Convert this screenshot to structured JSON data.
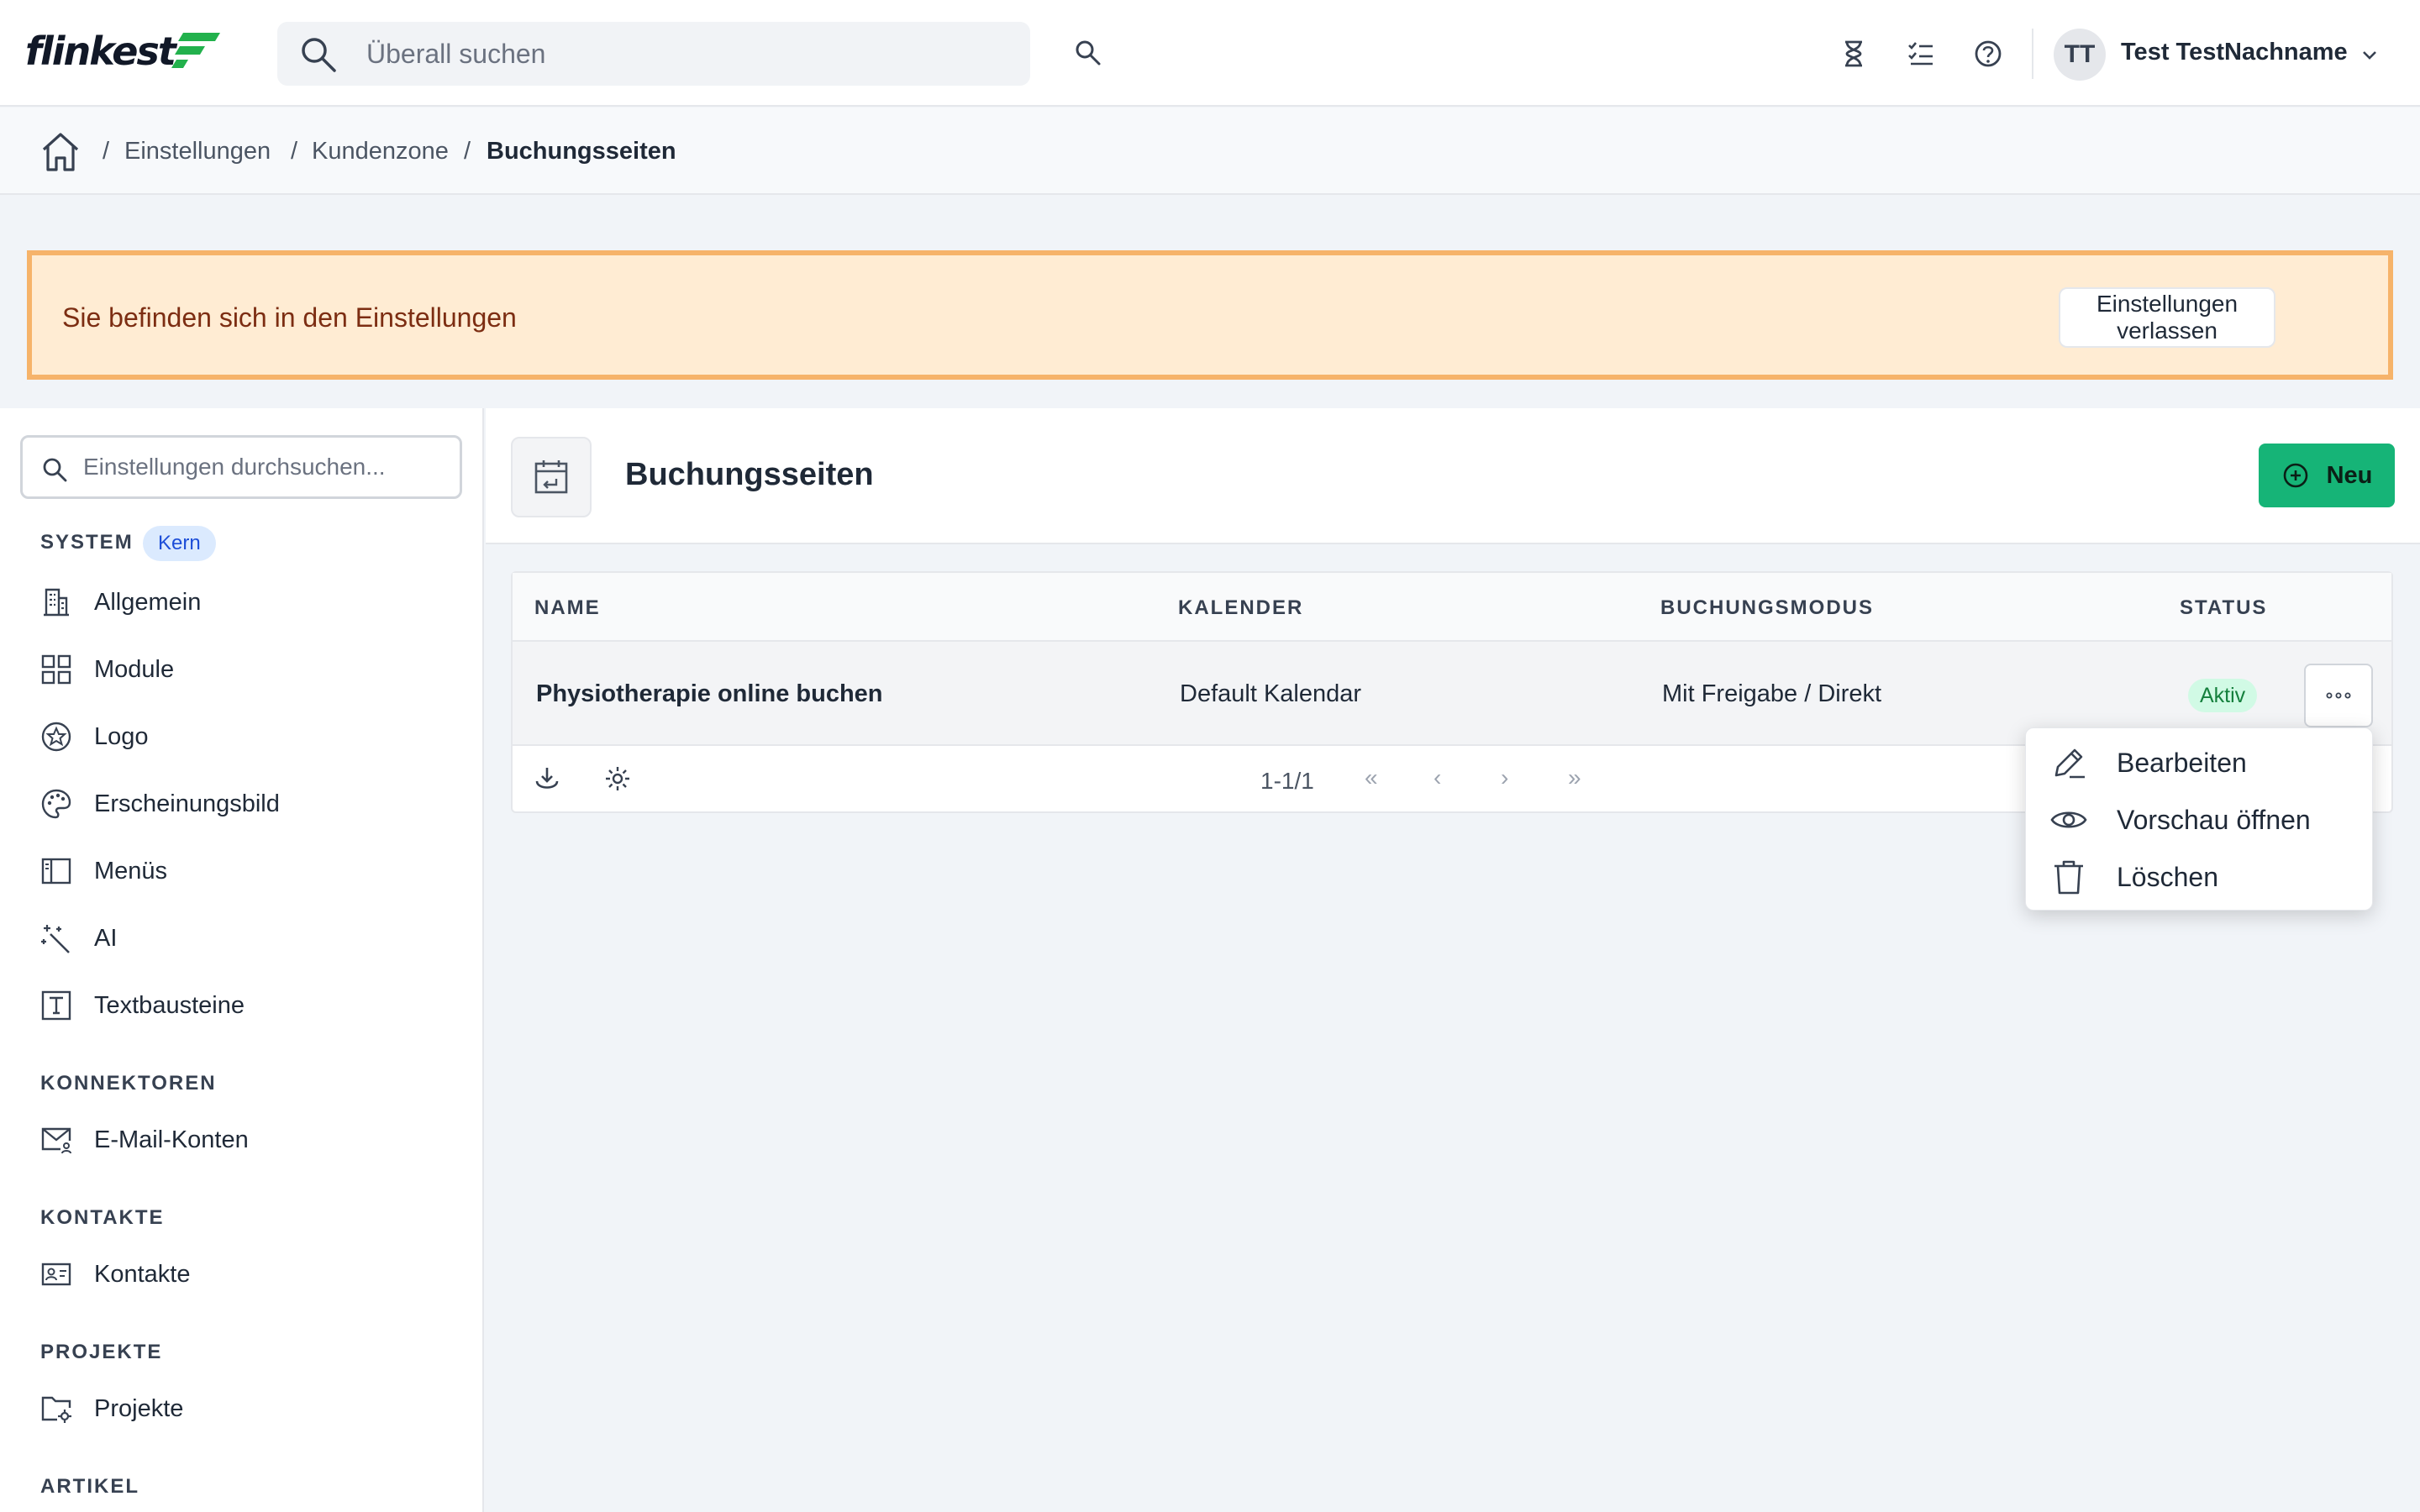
{
  "app": {
    "logo_text": "flinkest"
  },
  "topbar": {
    "search_placeholder": "Überall suchen",
    "icons": [
      "search-icon",
      "hourglass-icon",
      "task-list-icon",
      "help-icon"
    ],
    "user_initials": "TT",
    "user_name": "Test TestNachname"
  },
  "breadcrumb": {
    "items": [
      "Einstellungen",
      "Kundenzone",
      "Buchungsseiten"
    ],
    "separator": "/"
  },
  "banner": {
    "text": "Sie befinden sich in den Einstellungen",
    "button_label": "Einstellungen verlassen"
  },
  "sidebar": {
    "search_placeholder": "Einstellungen durchsuchen...",
    "sections": [
      {
        "title": "SYSTEM",
        "badge": "Kern",
        "items": [
          {
            "label": "Allgemein",
            "icon": "building-icon"
          },
          {
            "label": "Module",
            "icon": "grid-icon"
          },
          {
            "label": "Logo",
            "icon": "star-badge-icon"
          },
          {
            "label": "Erscheinungsbild",
            "icon": "palette-icon"
          },
          {
            "label": "Menüs",
            "icon": "sidebar-layout-icon"
          },
          {
            "label": "AI",
            "icon": "magic-wand-icon"
          },
          {
            "label": "Textbausteine",
            "icon": "text-block-icon"
          }
        ]
      },
      {
        "title": "KONNEKTOREN",
        "items": [
          {
            "label": "E-Mail-Konten",
            "icon": "mail-user-icon"
          }
        ]
      },
      {
        "title": "KONTAKTE",
        "items": [
          {
            "label": "Kontakte",
            "icon": "contact-card-icon"
          }
        ]
      },
      {
        "title": "PROJEKTE",
        "items": [
          {
            "label": "Projekte",
            "icon": "folder-gear-icon"
          }
        ]
      },
      {
        "title": "ARTIKEL",
        "items": []
      }
    ]
  },
  "page": {
    "title": "Buchungsseiten",
    "icon": "calendar-return-icon",
    "new_button_label": "Neu"
  },
  "table": {
    "columns": [
      "NAME",
      "KALENDER",
      "BUCHUNGSMODUS",
      "STATUS"
    ],
    "rows": [
      {
        "name": "Physiotherapie online buchen",
        "calendar": "Default Kalendar",
        "mode": "Mit Freigabe / Direkt",
        "status": "Aktiv"
      }
    ],
    "footer": {
      "pagination_text": "1-1/1",
      "first": "«",
      "prev": "‹",
      "next": "›",
      "last": "»"
    }
  },
  "row_menu": {
    "items": [
      {
        "label": "Bearbeiten",
        "icon": "pencil-icon"
      },
      {
        "label": "Vorschau öffnen",
        "icon": "eye-icon"
      },
      {
        "label": "Löschen",
        "icon": "trash-icon"
      }
    ]
  },
  "colors": {
    "primary_button": "#16b477",
    "banner_bg": "#ffecd3",
    "banner_border": "#f6b36a",
    "status_active_bg": "#d1fae5"
  }
}
